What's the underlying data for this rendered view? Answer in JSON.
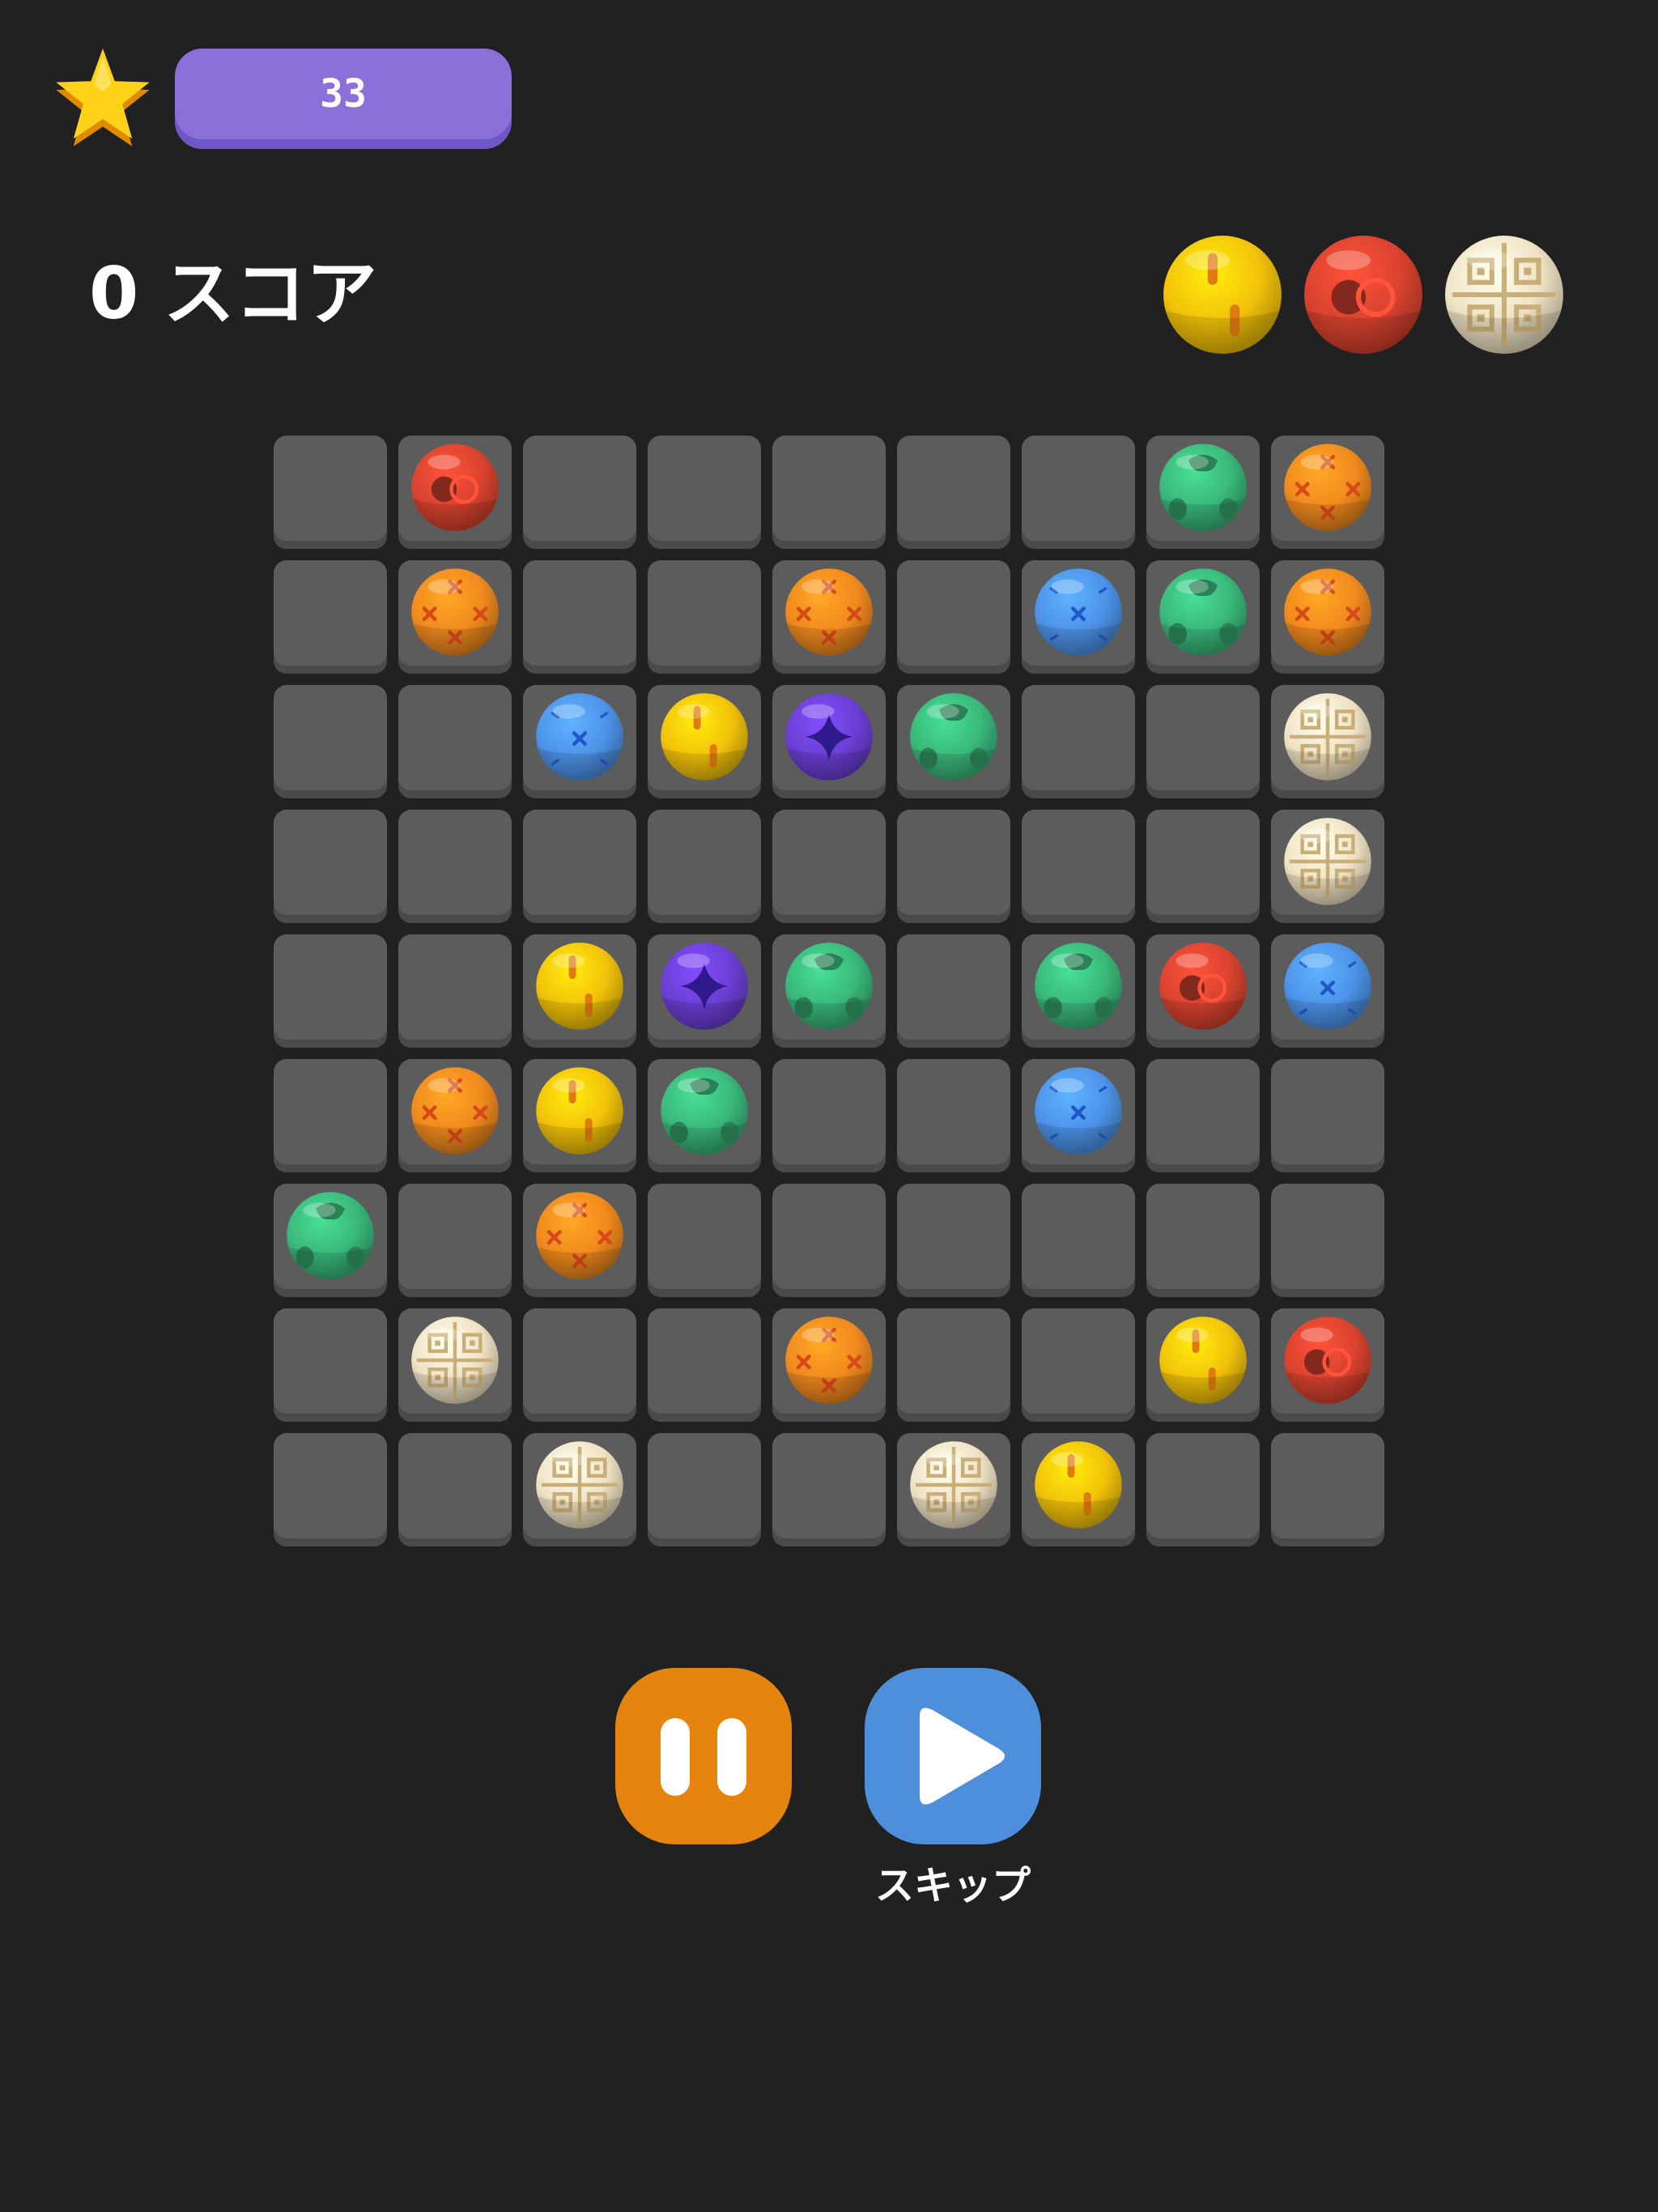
{
  "header": {
    "level_value": "33",
    "score_text": "0 スコア"
  },
  "next_balls": [
    "yellow",
    "red",
    "cream"
  ],
  "board": {
    "rows": 9,
    "cols": 9,
    "cells": [
      [
        null,
        "red",
        null,
        null,
        null,
        null,
        null,
        "green",
        "orange"
      ],
      [
        null,
        "orange",
        null,
        null,
        "orange",
        null,
        "blue",
        "green",
        "orange"
      ],
      [
        null,
        null,
        "blue",
        "yellow",
        "purple",
        "green",
        null,
        null,
        "cream"
      ],
      [
        null,
        null,
        null,
        null,
        null,
        null,
        null,
        null,
        "cream"
      ],
      [
        null,
        null,
        "yellow",
        "purple",
        "green",
        null,
        "green",
        "red",
        "blue"
      ],
      [
        null,
        "orange",
        "yellow",
        "green",
        null,
        null,
        "blue",
        null,
        null
      ],
      [
        "green",
        null,
        "orange",
        null,
        null,
        null,
        null,
        null,
        null
      ],
      [
        null,
        "cream",
        null,
        null,
        "orange",
        null,
        null,
        "yellow",
        "red"
      ],
      [
        null,
        null,
        "cream",
        null,
        null,
        "cream",
        "yellow",
        null,
        null
      ]
    ]
  },
  "controls": {
    "skip_label": "スキップ"
  },
  "colors": {
    "background": "#212121",
    "cell": "#5c5c5c",
    "level_pill": "#8a70d8",
    "pause_button": "#e5850f",
    "skip_button": "#4e8fdc",
    "red": "#d9432f",
    "orange": "#f08a1e",
    "green": "#3ab87a",
    "blue": "#4d93e8",
    "yellow": "#f2c20a",
    "purple": "#6b3fd4",
    "cream": "#efe2c4"
  }
}
